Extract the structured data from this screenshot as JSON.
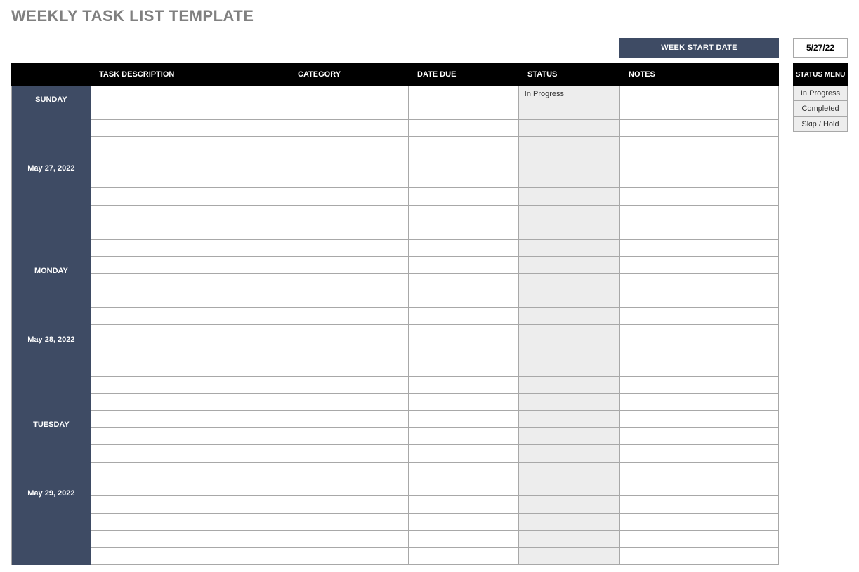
{
  "title": "WEEKLY TASK LIST TEMPLATE",
  "week_start": {
    "label": "WEEK START DATE",
    "date": "5/27/22"
  },
  "columns": {
    "task": "TASK DESCRIPTION",
    "category": "CATEGORY",
    "due": "DATE DUE",
    "status": "STATUS",
    "notes": "NOTES"
  },
  "status_menu": {
    "header": "STATUS MENU",
    "items": [
      "In Progress",
      "Completed",
      "Skip / Hold"
    ]
  },
  "days": [
    {
      "name": "SUNDAY",
      "date": "May 27, 2022",
      "rows": [
        {
          "task": "",
          "category": "",
          "due": "",
          "status": "In Progress",
          "notes": ""
        },
        {
          "task": "",
          "category": "",
          "due": "",
          "status": "",
          "notes": ""
        },
        {
          "task": "",
          "category": "",
          "due": "",
          "status": "",
          "notes": ""
        },
        {
          "task": "",
          "category": "",
          "due": "",
          "status": "",
          "notes": ""
        },
        {
          "task": "",
          "category": "",
          "due": "",
          "status": "",
          "notes": ""
        },
        {
          "task": "",
          "category": "",
          "due": "",
          "status": "",
          "notes": ""
        },
        {
          "task": "",
          "category": "",
          "due": "",
          "status": "",
          "notes": ""
        },
        {
          "task": "",
          "category": "",
          "due": "",
          "status": "",
          "notes": ""
        },
        {
          "task": "",
          "category": "",
          "due": "",
          "status": "",
          "notes": ""
        },
        {
          "task": "",
          "category": "",
          "due": "",
          "status": "",
          "notes": ""
        }
      ]
    },
    {
      "name": "MONDAY",
      "date": "May 28, 2022",
      "rows": [
        {
          "task": "",
          "category": "",
          "due": "",
          "status": "",
          "notes": ""
        },
        {
          "task": "",
          "category": "",
          "due": "",
          "status": "",
          "notes": ""
        },
        {
          "task": "",
          "category": "",
          "due": "",
          "status": "",
          "notes": ""
        },
        {
          "task": "",
          "category": "",
          "due": "",
          "status": "",
          "notes": ""
        },
        {
          "task": "",
          "category": "",
          "due": "",
          "status": "",
          "notes": ""
        },
        {
          "task": "",
          "category": "",
          "due": "",
          "status": "",
          "notes": ""
        },
        {
          "task": "",
          "category": "",
          "due": "",
          "status": "",
          "notes": ""
        },
        {
          "task": "",
          "category": "",
          "due": "",
          "status": "",
          "notes": ""
        },
        {
          "task": "",
          "category": "",
          "due": "",
          "status": "",
          "notes": ""
        }
      ]
    },
    {
      "name": "TUESDAY",
      "date": "May 29, 2022",
      "rows": [
        {
          "task": "",
          "category": "",
          "due": "",
          "status": "",
          "notes": ""
        },
        {
          "task": "",
          "category": "",
          "due": "",
          "status": "",
          "notes": ""
        },
        {
          "task": "",
          "category": "",
          "due": "",
          "status": "",
          "notes": ""
        },
        {
          "task": "",
          "category": "",
          "due": "",
          "status": "",
          "notes": ""
        },
        {
          "task": "",
          "category": "",
          "due": "",
          "status": "",
          "notes": ""
        },
        {
          "task": "",
          "category": "",
          "due": "",
          "status": "",
          "notes": ""
        },
        {
          "task": "",
          "category": "",
          "due": "",
          "status": "",
          "notes": ""
        },
        {
          "task": "",
          "category": "",
          "due": "",
          "status": "",
          "notes": ""
        },
        {
          "task": "",
          "category": "",
          "due": "",
          "status": "",
          "notes": ""
        }
      ]
    }
  ]
}
